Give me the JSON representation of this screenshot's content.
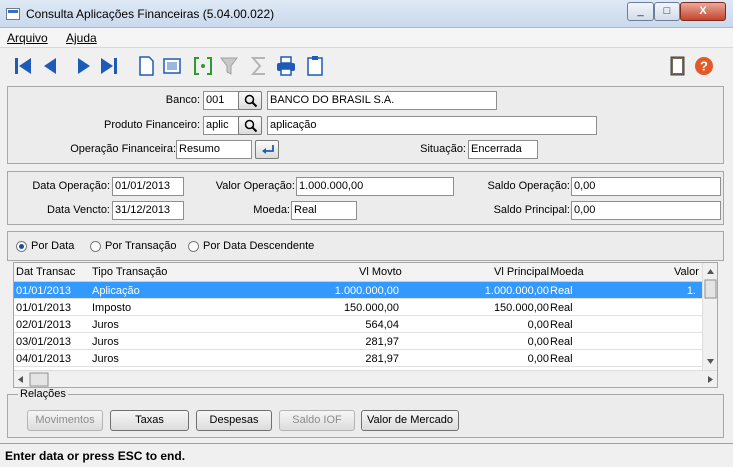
{
  "window": {
    "title": "Consulta Aplicações Financeiras (5.04.00.022)",
    "min": "_",
    "max": "□",
    "close": "X"
  },
  "menu": {
    "arquivo": "Arquivo",
    "ajuda": "Ajuda"
  },
  "form": {
    "banco_label": "Banco:",
    "banco_code": "001",
    "banco_name": "BANCO DO BRASIL S.A.",
    "produto_label": "Produto Financeiro:",
    "produto_code": "aplic",
    "produto_name": "aplicação",
    "operacao_label": "Operação Financeira:",
    "operacao_value": "Resumo",
    "situacao_label": "Situação:",
    "situacao_value": "Encerrada"
  },
  "details": {
    "data_operacao_label": "Data Operação:",
    "data_operacao": "01/01/2013",
    "valor_operacao_label": "Valor Operação:",
    "valor_operacao": "1.000.000,00",
    "saldo_operacao_label": "Saldo Operação:",
    "saldo_operacao": "0,00",
    "data_vencto_label": "Data Vencto:",
    "data_vencto": "31/12/2013",
    "moeda_label": "Moeda:",
    "moeda": "Real",
    "saldo_principal_label": "Saldo Principal:",
    "saldo_principal": "0,00"
  },
  "sort": {
    "por_data": "Por Data",
    "por_transacao": "Por Transação",
    "por_data_desc": "Por Data Descendente",
    "selected": "por_data"
  },
  "grid": {
    "headers": {
      "dat_transac": "Dat Transac",
      "tipo": "Tipo Transação",
      "vl_movto": "Vl Movto",
      "vl_principal": "Vl Principal",
      "moeda": "Moeda",
      "valor": "Valor"
    },
    "rows": [
      {
        "dat": "01/01/2013",
        "tipo": "Aplicação",
        "vl_movto": "1.000.000,00",
        "vl_principal": "1.000.000,00",
        "moeda": "Real",
        "valor": "1."
      },
      {
        "dat": "01/01/2013",
        "tipo": "Imposto",
        "vl_movto": "150.000,00",
        "vl_principal": "150.000,00",
        "moeda": "Real",
        "valor": ""
      },
      {
        "dat": "02/01/2013",
        "tipo": "Juros",
        "vl_movto": "564,04",
        "vl_principal": "0,00",
        "moeda": "Real",
        "valor": ""
      },
      {
        "dat": "03/01/2013",
        "tipo": "Juros",
        "vl_movto": "281,97",
        "vl_principal": "0,00",
        "moeda": "Real",
        "valor": ""
      },
      {
        "dat": "04/01/2013",
        "tipo": "Juros",
        "vl_movto": "281,97",
        "vl_principal": "0,00",
        "moeda": "Real",
        "valor": ""
      }
    ]
  },
  "relacoes": {
    "label": "Relações",
    "movimentos": "Movimentos",
    "taxas": "Taxas",
    "despesas": "Despesas",
    "saldo_iof": "Saldo IOF",
    "valor_mercado": "Valor de Mercado"
  },
  "status": "Enter data or press ESC to end.",
  "colors": {
    "accent": "#1e5bb8",
    "selection": "#3399ff"
  },
  "icons": [
    "first-icon",
    "prev-icon",
    "next-icon",
    "last-icon",
    "new-icon",
    "view-icon",
    "bracket-select-icon",
    "filter-icon",
    "sum-icon",
    "print-icon",
    "clipboard-icon",
    "exit-door-icon",
    "help-icon",
    "search-icon",
    "enter-icon"
  ]
}
